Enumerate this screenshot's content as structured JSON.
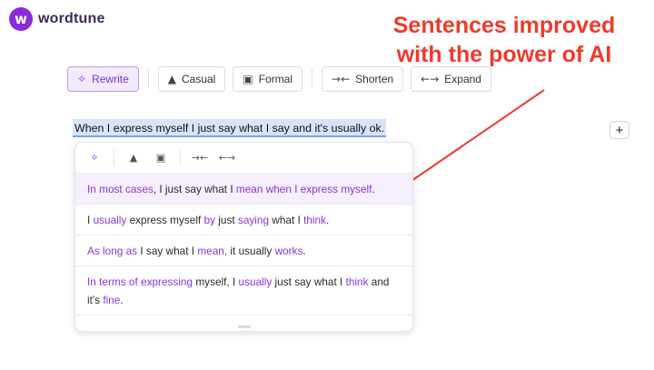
{
  "app": {
    "logo_letter": "w",
    "logo_text": "wordtune"
  },
  "headline": {
    "line1": "Sentences improved",
    "line2": "with the power of AI"
  },
  "toolbar": {
    "rewrite": "Rewrite",
    "casual": "Casual",
    "formal": "Formal",
    "shorten": "Shorten",
    "expand": "Expand"
  },
  "icons": {
    "rewrite": "sparkles-icon",
    "casual": "sneaker-icon",
    "formal": "briefcase-icon",
    "shorten": "arrows-inward-icon",
    "expand": "arrows-outward-icon",
    "plus": "plus-icon"
  },
  "editor": {
    "selected_text": "When I express myself I just say what I say and it's usually ok.",
    "plus_label": "+"
  },
  "suggestions": [
    {
      "parts": [
        {
          "t": "In most cases",
          "h": true
        },
        {
          "t": ", I just say what I ",
          "h": false
        },
        {
          "t": "mean when I express myself",
          "h": true
        },
        {
          "t": ".",
          "h": false
        }
      ]
    },
    {
      "parts": [
        {
          "t": "I ",
          "h": false
        },
        {
          "t": "usually",
          "h": true
        },
        {
          "t": " express myself ",
          "h": false
        },
        {
          "t": "by",
          "h": true
        },
        {
          "t": " just ",
          "h": false
        },
        {
          "t": "saying",
          "h": true
        },
        {
          "t": " what I ",
          "h": false
        },
        {
          "t": "think",
          "h": true
        },
        {
          "t": ".",
          "h": false
        }
      ]
    },
    {
      "parts": [
        {
          "t": "As long as",
          "h": true
        },
        {
          "t": " I say what I ",
          "h": false
        },
        {
          "t": "mean,",
          "h": true
        },
        {
          "t": " it usually ",
          "h": false
        },
        {
          "t": "works",
          "h": true
        },
        {
          "t": ".",
          "h": false
        }
      ]
    },
    {
      "parts": [
        {
          "t": "In terms of expressing",
          "h": true
        },
        {
          "t": " myself, I ",
          "h": false
        },
        {
          "t": "usually",
          "h": true
        },
        {
          "t": " just say what I ",
          "h": false
        },
        {
          "t": "think",
          "h": true
        },
        {
          "t": " and it's ",
          "h": false
        },
        {
          "t": "fine",
          "h": true
        },
        {
          "t": ".",
          "h": false
        }
      ]
    }
  ],
  "colors": {
    "brand": "#8b2bd9",
    "highlight": "#8b35d6",
    "headline": "#ee3b2b"
  }
}
